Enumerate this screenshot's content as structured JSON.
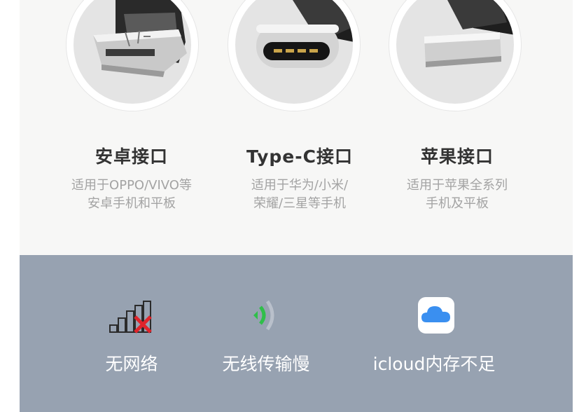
{
  "connectors": [
    {
      "title": "安卓接口",
      "desc_line1": "适用于OPPO/VIVO等",
      "desc_line2": "安卓手机和平板",
      "icon": "micro-usb-connector"
    },
    {
      "title": "Type-C接口",
      "desc_line1": "适用于华为/小米/",
      "desc_line2": "荣耀/三星等手机",
      "icon": "usb-c-connector"
    },
    {
      "title": "苹果接口",
      "desc_line1": "适用于苹果全系列",
      "desc_line2": "手机及平板",
      "icon": "lightning-connector"
    }
  ],
  "problems": [
    {
      "label": "无网络",
      "icon": "no-signal-icon"
    },
    {
      "label": "无线传输慢",
      "icon": "weak-wifi-icon"
    },
    {
      "label": "icloud内存不足",
      "icon": "icloud-icon"
    }
  ],
  "colors": {
    "top_bg": "#f7f7f6",
    "bottom_bg": "#97a2b1",
    "title": "#333333",
    "desc": "#a3a3a3",
    "cross": "#e0242b",
    "wifi": "#2fbf4a",
    "cloud": "#2f86e8"
  }
}
